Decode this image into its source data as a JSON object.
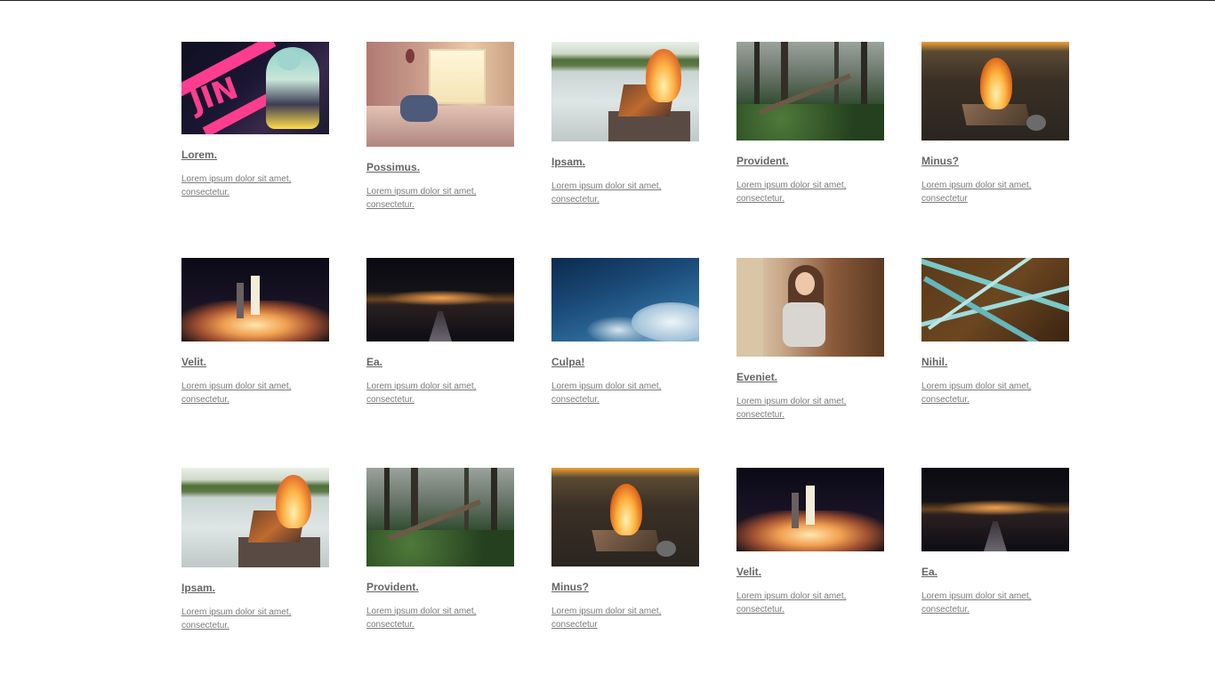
{
  "gallery": {
    "items": [
      {
        "title": "Lorem.",
        "desc": "Lorem ipsum dolor sit amet, consectetur.",
        "image": "anime-robot-girl"
      },
      {
        "title": "Possimus.",
        "desc": "Lorem ipsum dolor sit amet, consectetur.",
        "image": "bedroom-window"
      },
      {
        "title": "Ipsam.",
        "desc": "Lorem ipsum dolor sit amet, consectetur.",
        "image": "lake-fire-basket"
      },
      {
        "title": "Provident.",
        "desc": "Lorem ipsum dolor sit amet, consectetur.",
        "image": "forest-path"
      },
      {
        "title": "Minus?",
        "desc": "Lorem ipsum dolor sit amet, consectetur",
        "image": "campfire-beach"
      },
      {
        "title": "Velit.",
        "desc": "Lorem ipsum dolor sit amet, consectetur.",
        "image": "rocket-launch"
      },
      {
        "title": "Ea.",
        "desc": "Lorem ipsum dolor sit amet, consectetur.",
        "image": "night-dock"
      },
      {
        "title": "Culpa!",
        "desc": "Lorem ipsum dolor sit amet, consectetur.",
        "image": "blue-sky-clouds"
      },
      {
        "title": "Eveniet.",
        "desc": "Lorem ipsum dolor sit amet, consectetur.",
        "image": "girl-in-doorway"
      },
      {
        "title": "Nihil.",
        "desc": "Lorem ipsum dolor sit amet, consectetur.",
        "image": "teal-ropes"
      },
      {
        "title": "Ipsam.",
        "desc": "Lorem ipsum dolor sit amet, consectetur.",
        "image": "lake-fire-basket"
      },
      {
        "title": "Provident.",
        "desc": "Lorem ipsum dolor sit amet, consectetur.",
        "image": "forest-path"
      },
      {
        "title": "Minus?",
        "desc": "Lorem ipsum dolor sit amet, consectetur",
        "image": "campfire-beach"
      },
      {
        "title": "Velit.",
        "desc": "Lorem ipsum dolor sit amet, consectetur.",
        "image": "rocket-launch"
      },
      {
        "title": "Ea.",
        "desc": "Lorem ipsum dolor sit amet, consectetur.",
        "image": "night-dock"
      }
    ]
  },
  "colors": {
    "page_background": "#ffffff",
    "title_text": "#666666",
    "desc_text": "#7a7a7a",
    "top_border": "#222222"
  }
}
